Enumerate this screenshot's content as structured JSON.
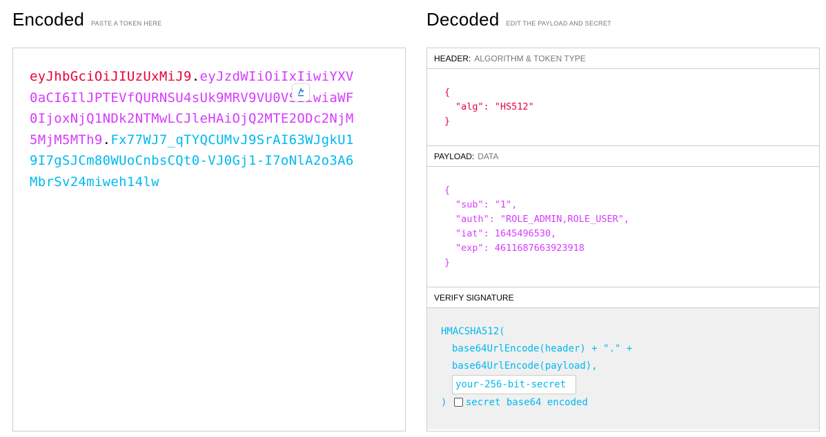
{
  "encoded": {
    "title": "Encoded",
    "subtitle": "PASTE A TOKEN HERE",
    "token_header": "eyJhbGciOiJIUzUxMiJ9",
    "token_payload": "eyJzdWIiOiIxIiwiYXV0aCI6IlJPTEVfQURNSU4sUk9MRV9VU0VSIiwiaWF0IjoxNjQ1NDk2NTMwLCJleHAiOjQ2MTE2ODc2NjM5MjM5MTh9",
    "token_signature": "Fx77WJ7_qTYQCUMvJ9SrAI63WJgkU19I7gSJCm80WUoCnbsCQt0-VJ0Gj1-I7oNlA2o3A6MbrSv24miweh14lw",
    "dot": "."
  },
  "decoded": {
    "title": "Decoded",
    "subtitle": "EDIT THE PAYLOAD AND SECRET",
    "header_section": {
      "label": "HEADER:",
      "desc": "ALGORITHM & TOKEN TYPE",
      "lines": [
        "{",
        "\"alg\": \"HS512\"",
        "}"
      ]
    },
    "payload_section": {
      "label": "PAYLOAD:",
      "desc": "DATA",
      "lines": [
        "{",
        "\"sub\": \"1\",",
        "\"auth\": \"ROLE_ADMIN,ROLE_USER\",",
        "\"iat\": 1645496530,",
        "\"exp\": 4611687663923918",
        "}"
      ]
    },
    "signature_section": {
      "label": "VERIFY SIGNATURE",
      "line1": "HMACSHA512(",
      "line2": "base64UrlEncode(header) + \".\" +",
      "line3": "base64UrlEncode(payload),",
      "secret_value": "your-256-bit-secret",
      "close": ")",
      "checkbox_label": "secret base64 encoded",
      "checkbox_checked": false
    }
  },
  "colors": {
    "header": "#e9003d",
    "payload": "#d63aff",
    "signature": "#00b9f1"
  }
}
